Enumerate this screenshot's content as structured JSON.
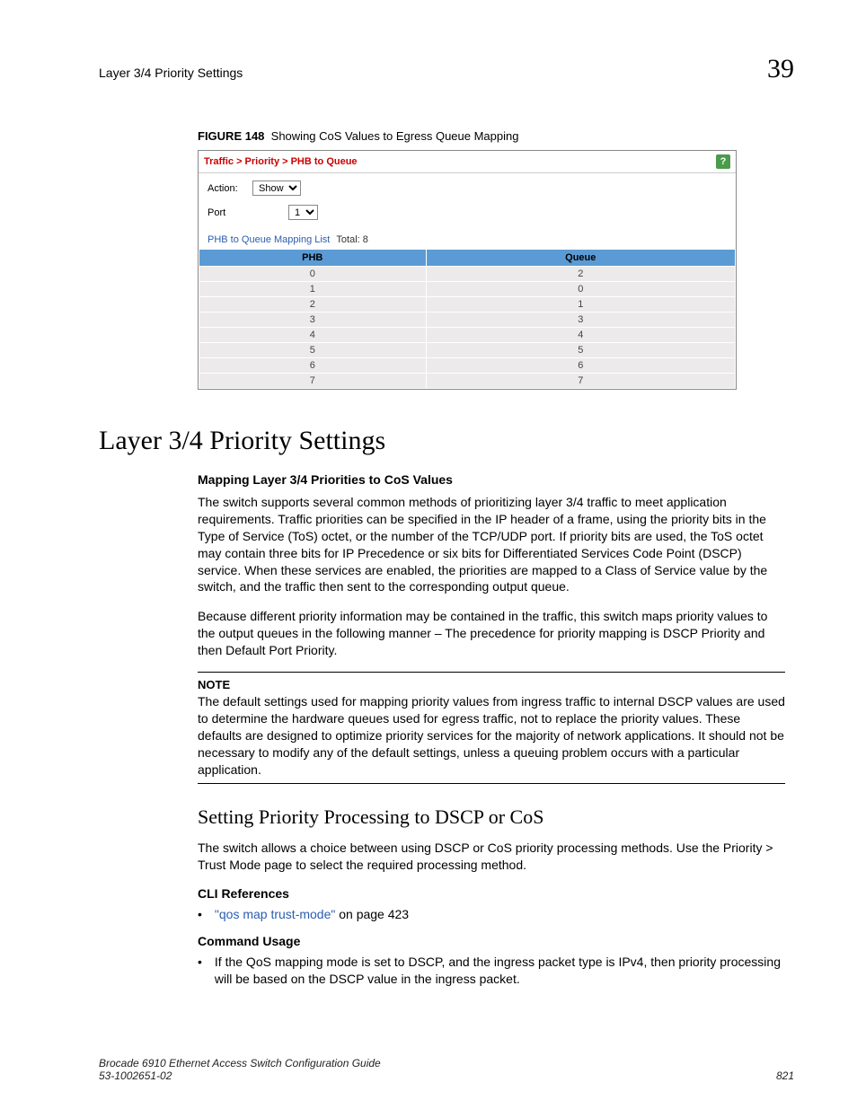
{
  "header": {
    "running_title": "Layer 3/4 Priority Settings",
    "chapter_number": "39"
  },
  "figure": {
    "label": "FIGURE 148",
    "caption": "Showing CoS Values to Egress Queue Mapping"
  },
  "screenshot": {
    "breadcrumb": "Traffic > Priority > PHB to Queue",
    "help_glyph": "?",
    "action_label": "Action:",
    "action_value": "Show",
    "port_label": "Port",
    "port_value": "1",
    "list_title": "PHB to Queue Mapping List",
    "list_total_label": "Total:",
    "list_total_value": "8",
    "col_phb": "PHB",
    "col_queue": "Queue",
    "rows": [
      {
        "phb": "0",
        "queue": "2"
      },
      {
        "phb": "1",
        "queue": "0"
      },
      {
        "phb": "2",
        "queue": "1"
      },
      {
        "phb": "3",
        "queue": "3"
      },
      {
        "phb": "4",
        "queue": "4"
      },
      {
        "phb": "5",
        "queue": "5"
      },
      {
        "phb": "6",
        "queue": "6"
      },
      {
        "phb": "7",
        "queue": "7"
      }
    ]
  },
  "section": {
    "h1": "Layer 3/4 Priority Settings",
    "sub1": "Mapping Layer 3/4 Priorities to CoS Values",
    "p1": "The switch supports several common methods of prioritizing layer 3/4 traffic to meet application requirements. Traffic priorities can be specified in the IP header of a frame, using the priority bits in the Type of Service (ToS) octet, or the number of the TCP/UDP port. If priority bits are used, the ToS octet may contain three bits for IP Precedence or six bits for Differentiated Services Code Point (DSCP) service. When these services are enabled, the priorities are mapped to a Class of Service value by the switch, and the traffic then sent to the corresponding output queue.",
    "p2": "Because different priority information may be contained in the traffic, this switch maps priority values to the output queues in the following manner – The precedence for priority mapping is DSCP Priority and then Default Port Priority.",
    "note_label": "NOTE",
    "note_body": "The default settings used for mapping priority values from ingress traffic to internal DSCP values are used to determine the hardware queues used for egress traffic, not to replace the priority values. These defaults are designed to optimize priority services for the majority of network applications. It should not be necessary to modify any of the default settings, unless a queuing problem occurs with a particular application.",
    "h2": "Setting Priority Processing to DSCP or CoS",
    "p3": "The switch allows a choice between using DSCP or CoS priority processing methods. Use the Priority > Trust Mode page to select the required processing method.",
    "cli_head": "CLI References",
    "cli_link": "\"qos map trust-mode\"",
    "cli_tail": " on page 423",
    "cmd_head": "Command Usage",
    "cmd_b1": "If the QoS mapping mode is set to DSCP, and the ingress packet type is IPv4, then priority processing will be based on the DSCP value in the ingress packet."
  },
  "footer": {
    "book": "Brocade 6910 Ethernet Access Switch Configuration Guide",
    "docnum": "53-1002651-02",
    "page": "821"
  }
}
